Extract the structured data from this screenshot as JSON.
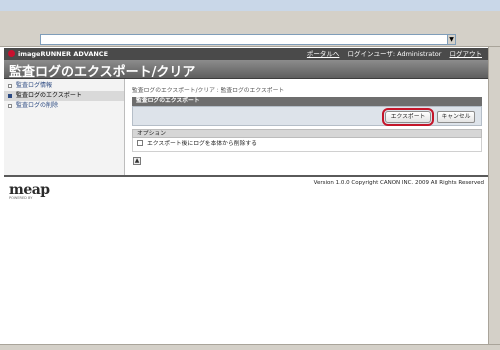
{
  "browser": {
    "address_value": "",
    "dropdown_glyph": "▼"
  },
  "header": {
    "brand": "imageRUNNER ADVANCE",
    "portal_link": "ポータルへ",
    "user_label": "ログインユーザ: Administrator",
    "logout_link": "ログアウト"
  },
  "page": {
    "title": "監査ログのエクスポート/クリア"
  },
  "sidebar": {
    "items": [
      {
        "label": "監査ログ情報",
        "active": false
      },
      {
        "label": "監査ログのエクスポート",
        "active": true
      },
      {
        "label": "監査ログの削除",
        "active": false
      }
    ]
  },
  "content": {
    "breadcrumb": "監査ログのエクスポート/クリア : 監査ログのエクスポート",
    "section_title": "監査ログのエクスポート",
    "export_button": "エクスポート",
    "cancel_button": "キャンセル",
    "options_title": "オプション",
    "option_checkbox_label": "エクスポート後にログを本体から削除する",
    "top_link_glyph": "▲"
  },
  "footer": {
    "logo": "meap",
    "logo_sub": "POWERED BY",
    "version": "Version 1.0.0 Copyright CANON INC. 2009 All Rights Reserved"
  },
  "colors": {
    "header_bg": "#4a4a4a",
    "title_bg": "#6e6e6e",
    "highlight": "#c4162a",
    "link": "#2c4a82"
  }
}
